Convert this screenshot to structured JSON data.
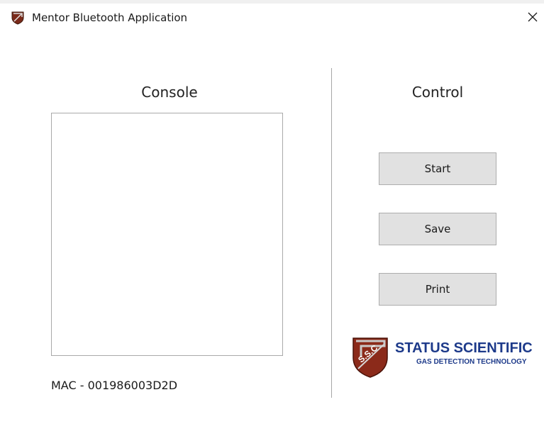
{
  "window": {
    "title": "Mentor Bluetooth Application",
    "app_icon": "shield-logo-icon",
    "close_icon": "close-icon"
  },
  "console": {
    "heading": "Console",
    "content": ""
  },
  "control": {
    "heading": "Control",
    "buttons": [
      {
        "label": "Start"
      },
      {
        "label": "Save"
      },
      {
        "label": "Print"
      }
    ]
  },
  "status": {
    "mac": "MAC - 001986003D2D"
  },
  "logo": {
    "shield_text": "S.S.C",
    "name": "STATUS SCIENTIFIC",
    "tagline": "GAS DETECTION TECHNOLOGY",
    "brand_color": "#1d3a8a",
    "shield_color": "#8b2a1a"
  }
}
